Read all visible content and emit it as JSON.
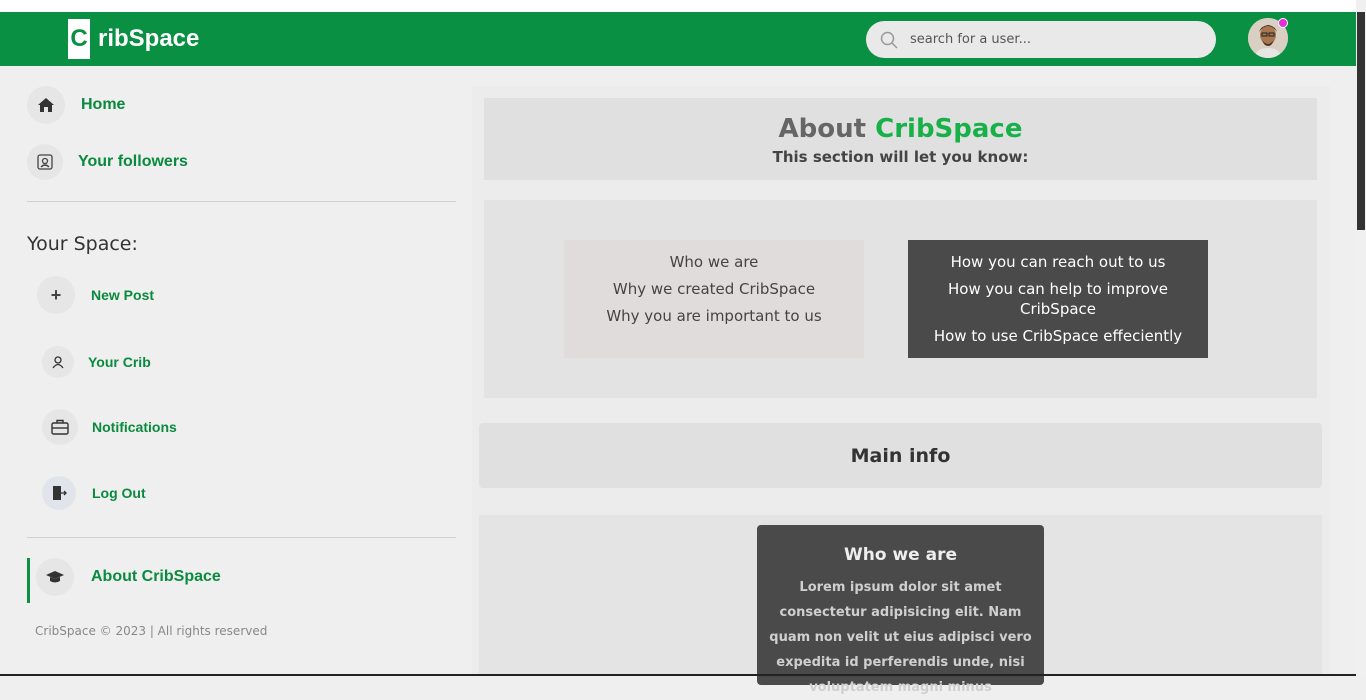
{
  "header": {
    "logo_letter": "C",
    "logo_text": "ribSpace",
    "search_placeholder": "search for a user..."
  },
  "sidebar": {
    "home": "Home",
    "followers": "Your followers",
    "section_title": "Your Space:",
    "new_post": "New Post",
    "new_post_icon_glyph": "+",
    "your_crib": "Your Crib",
    "notifications": "Notifications",
    "log_out": "Log Out",
    "about": "About CribSpace",
    "footer": "CribSpace © 2023 | All rights reserved"
  },
  "main": {
    "about_prefix": "About",
    "about_brand": "CribSpace",
    "about_subtitle": "This section will let you know:",
    "light_card": [
      "Who we are",
      "Why we created CribSpace",
      "Why you are important to us"
    ],
    "dark_card": [
      "How you can reach out to us",
      "How you can help to improve CribSpace",
      "How to use CribSpace effeciently"
    ],
    "main_info": "Main info",
    "who_title": "Who we are",
    "who_text": "Lorem ipsum dolor sit amet consectetur adipisicing elit. Nam quam non velit ut eius adipisci vero expedita id perferendis unde, nisi voluptatem magni minus"
  },
  "colors": {
    "brand_green": "#0a9043",
    "accent_green": "#18b048",
    "notification_dot": "#e62ddb"
  }
}
